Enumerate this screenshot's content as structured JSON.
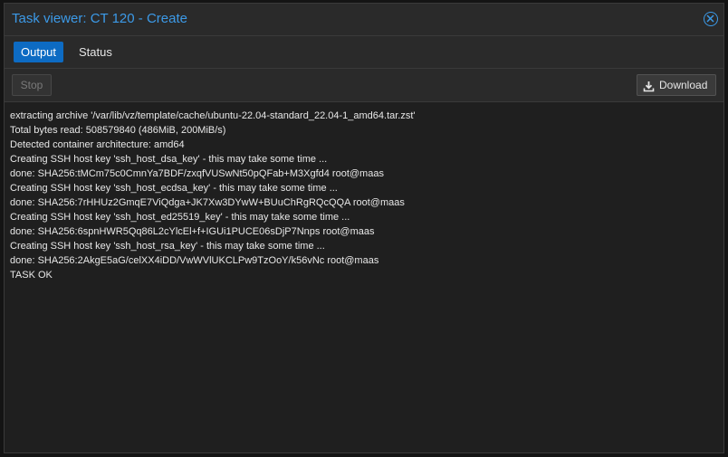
{
  "window": {
    "title": "Task viewer: CT 120 - Create"
  },
  "tabs": [
    {
      "label": "Output",
      "active": true
    },
    {
      "label": "Status",
      "active": false
    }
  ],
  "toolbar": {
    "stop_label": "Stop",
    "download_label": "Download"
  },
  "icons": {
    "close": "close-icon",
    "download": "download-icon"
  },
  "colors": {
    "accent": "#3c9ae8",
    "active_tab": "#0d6bc3"
  },
  "log": {
    "lines": [
      "extracting archive '/var/lib/vz/template/cache/ubuntu-22.04-standard_22.04-1_amd64.tar.zst'",
      "Total bytes read: 508579840 (486MiB, 200MiB/s)",
      "Detected container architecture: amd64",
      "Creating SSH host key 'ssh_host_dsa_key' - this may take some time ...",
      "done: SHA256:tMCm75c0CmnYa7BDF/zxqfVUSwNt50pQFab+M3Xgfd4 root@maas",
      "Creating SSH host key 'ssh_host_ecdsa_key' - this may take some time ...",
      "done: SHA256:7rHHUz2GmqE7ViQdga+JK7Xw3DYwW+BUuChRgRQcQQA root@maas",
      "Creating SSH host key 'ssh_host_ed25519_key' - this may take some time ...",
      "done: SHA256:6spnHWR5Qq86L2cYlcEl+f+IGUi1PUCE06sDjP7Nnps root@maas",
      "Creating SSH host key 'ssh_host_rsa_key' - this may take some time ...",
      "done: SHA256:2AkgE5aG/celXX4iDD/VwWVlUKCLPw9TzOoY/k56vNc root@maas",
      "TASK OK"
    ]
  }
}
